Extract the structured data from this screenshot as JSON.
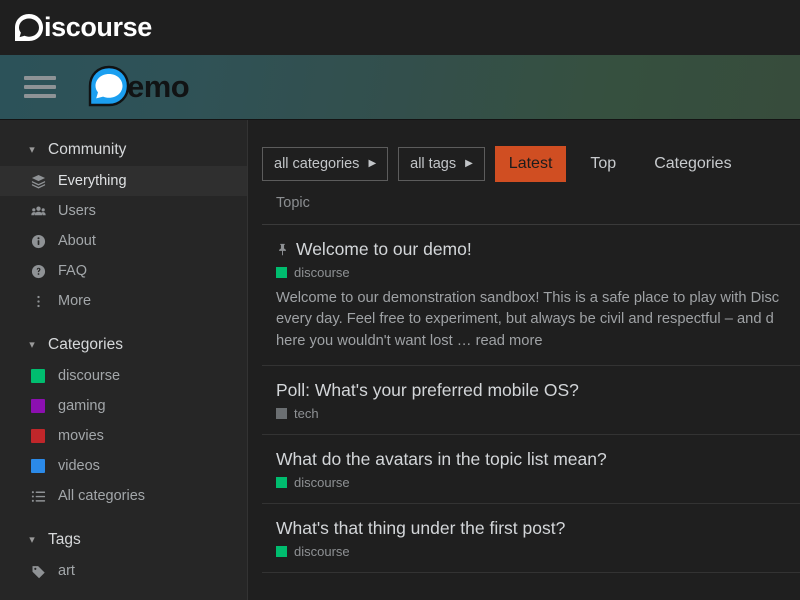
{
  "brandbar": {
    "logo_icon": "discourse-speech-bubble-icon",
    "name": "iscourse"
  },
  "siteheader": {
    "hamburger_icon": "hamburger-menu-icon",
    "logo_icon": "demo-speech-bubble-icon",
    "site_name": "emo",
    "gradient_start": "#2c5259",
    "gradient_end": "#374c3c"
  },
  "sidebar": {
    "sections": [
      {
        "title": "Community",
        "chevron_icon": "chevron-down-icon",
        "items": [
          {
            "label": "Everything",
            "icon": "layers-icon",
            "active": true
          },
          {
            "label": "Users",
            "icon": "users-icon",
            "active": false
          },
          {
            "label": "About",
            "icon": "info-circle-icon",
            "active": false
          },
          {
            "label": "FAQ",
            "icon": "question-circle-icon",
            "active": false
          },
          {
            "label": "More",
            "icon": "vertical-ellipsis-icon",
            "active": false
          }
        ]
      },
      {
        "title": "Categories",
        "chevron_icon": "chevron-down-icon",
        "items": [
          {
            "label": "discourse",
            "icon": "color-swatch",
            "color": "#00bd6f"
          },
          {
            "label": "gaming",
            "icon": "color-swatch",
            "color": "#8c0fb0"
          },
          {
            "label": "movies",
            "icon": "color-swatch",
            "color": "#c0262a"
          },
          {
            "label": "videos",
            "icon": "color-swatch",
            "color": "#2b8ae8"
          },
          {
            "label": "All categories",
            "icon": "list-icon"
          }
        ]
      },
      {
        "title": "Tags",
        "chevron_icon": "chevron-down-icon",
        "items": [
          {
            "label": "art",
            "icon": "tag-icon"
          }
        ]
      }
    ]
  },
  "main": {
    "filters": [
      {
        "label": "all categories",
        "caret_icon": "caret-right-icon"
      },
      {
        "label": "all tags",
        "caret_icon": "caret-right-icon"
      }
    ],
    "nav_pills": [
      {
        "label": "Latest",
        "active": true
      },
      {
        "label": "Top",
        "active": false
      },
      {
        "label": "Categories",
        "active": false
      }
    ],
    "accent_color": "#d04e22",
    "table_header": {
      "topic_column": "Topic"
    },
    "topics": [
      {
        "title": "Welcome to our demo!",
        "pinned": true,
        "pin_icon": "pin-icon",
        "category": "discourse",
        "category_color": "#00bd6f",
        "excerpt_lines": [
          "Welcome to our demonstration sandbox! This is a safe place to play with Disc",
          "every day. Feel free to experiment, but always be civil and respectful – and d",
          "here you wouldn't want lost …"
        ],
        "read_more": "read more"
      },
      {
        "title": "Poll: What's your preferred mobile OS?",
        "pinned": false,
        "category": "tech",
        "category_color": "#6b6f72"
      },
      {
        "title": "What do the avatars in the topic list mean?",
        "pinned": false,
        "category": "discourse",
        "category_color": "#00bd6f"
      },
      {
        "title": "What's that thing under the first post?",
        "pinned": false,
        "category": "discourse",
        "category_color": "#00bd6f"
      }
    ]
  }
}
